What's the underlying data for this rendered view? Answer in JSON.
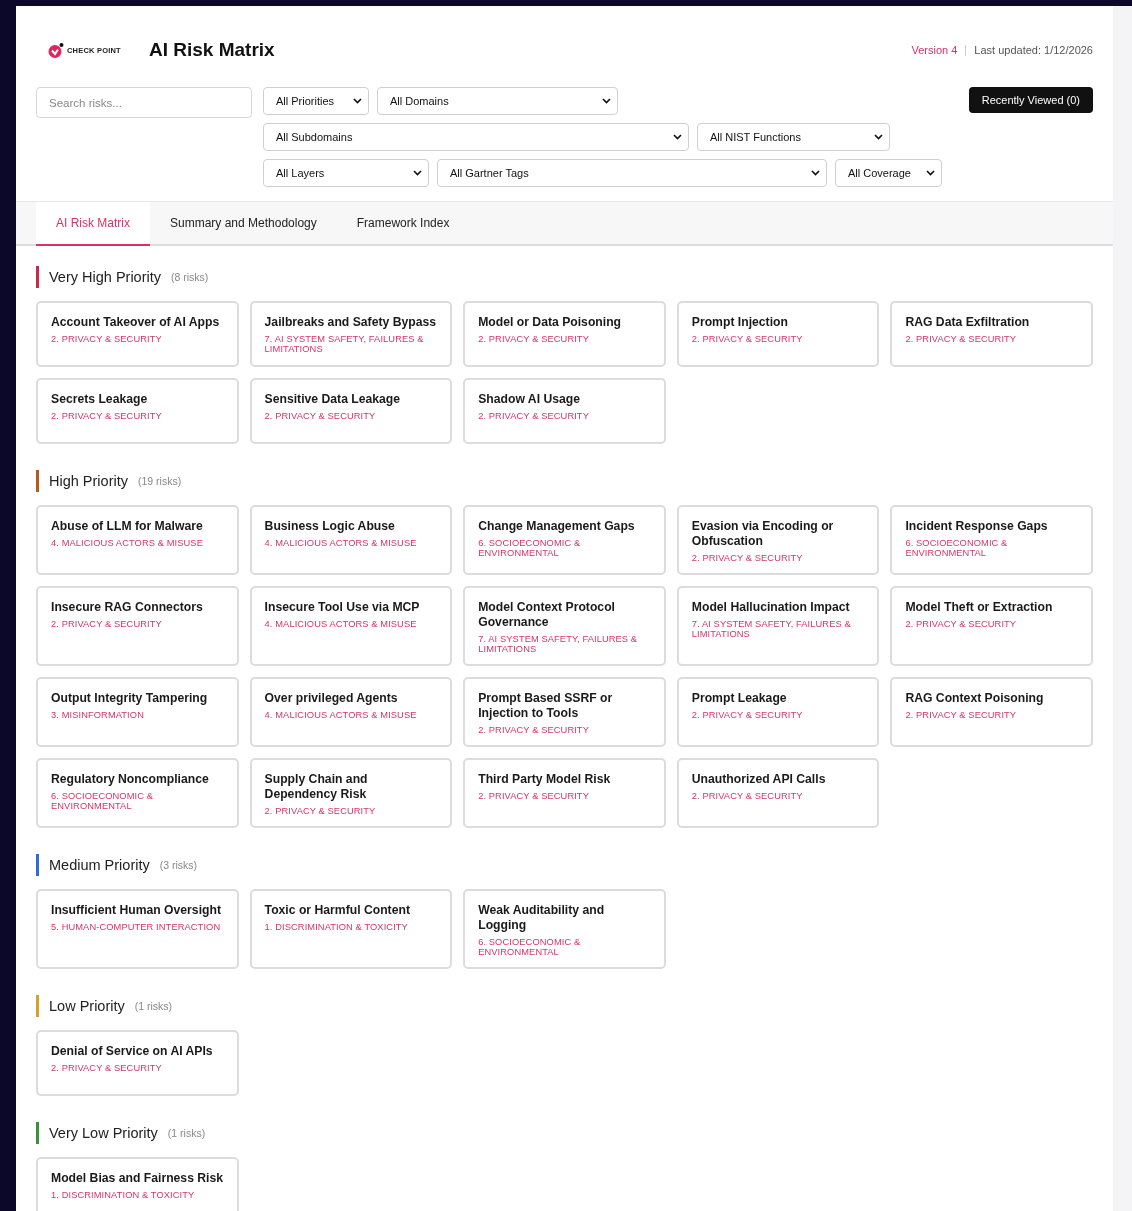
{
  "header": {
    "logo_text": "CHECK POINT",
    "title": "AI Risk Matrix",
    "version": "Version 4",
    "last_updated": "Last updated: 1/12/2026"
  },
  "filters": {
    "search": {
      "placeholder": "Search risks..."
    },
    "rows": [
      [
        {
          "label": "All Priorities"
        },
        {
          "label": "All Domains"
        }
      ],
      [
        {
          "label": "All Subdomains"
        },
        {
          "label": "All NIST Functions"
        }
      ],
      [
        {
          "label": "All Layers"
        },
        {
          "label": "All Gartner Tags"
        },
        {
          "label": "All Coverage"
        }
      ]
    ],
    "button": "Recently Viewed (0)"
  },
  "tabs": [
    {
      "label": "AI Risk Matrix",
      "selected": true
    },
    {
      "label": "Summary and Methodology",
      "selected": false
    },
    {
      "label": "Framework Index",
      "selected": false
    }
  ],
  "sections": [
    {
      "title": "Very High Priority",
      "count": "(8 risks)",
      "color": "#c8284a",
      "risks": [
        {
          "title": "Account Takeover of AI Apps",
          "category": "2. PRIVACY & SECURITY"
        },
        {
          "title": "Jailbreaks and Safety Bypass",
          "category": "7. AI SYSTEM SAFETY, FAILURES & LIMITATIONS"
        },
        {
          "title": "Model or Data Poisoning",
          "category": "2. PRIVACY & SECURITY"
        },
        {
          "title": "Prompt Injection",
          "category": "2. PRIVACY & SECURITY"
        },
        {
          "title": "RAG Data Exfiltration",
          "category": "2. PRIVACY & SECURITY"
        },
        {
          "title": "Secrets Leakage",
          "category": "2. PRIVACY & SECURITY"
        },
        {
          "title": "Sensitive Data Leakage",
          "category": "2. PRIVACY & SECURITY"
        },
        {
          "title": "Shadow AI Usage",
          "category": "2. PRIVACY & SECURITY"
        }
      ]
    },
    {
      "title": "High Priority",
      "count": "(19 risks)",
      "color": "#b4591f",
      "risks": [
        {
          "title": "Abuse of LLM for Malware",
          "category": "4. MALICIOUS ACTORS & MISUSE"
        },
        {
          "title": "Business Logic Abuse",
          "category": "4. MALICIOUS ACTORS & MISUSE"
        },
        {
          "title": "Change Management Gaps",
          "category": "6. SOCIOECONOMIC & ENVIRONMENTAL"
        },
        {
          "title": "Evasion via Encoding or Obfuscation",
          "category": "2. PRIVACY & SECURITY"
        },
        {
          "title": "Incident Response Gaps",
          "category": "6. SOCIOECONOMIC & ENVIRONMENTAL"
        },
        {
          "title": "Insecure RAG Connectors",
          "category": "2. PRIVACY & SECURITY"
        },
        {
          "title": "Insecure Tool Use via MCP",
          "category": "4. MALICIOUS ACTORS & MISUSE"
        },
        {
          "title": "Model Context Protocol Governance",
          "category": "7. AI SYSTEM SAFETY, FAILURES & LIMITATIONS"
        },
        {
          "title": "Model Hallucination Impact",
          "category": "7. AI SYSTEM SAFETY, FAILURES & LIMITATIONS"
        },
        {
          "title": "Model Theft or Extraction",
          "category": "2. PRIVACY & SECURITY"
        },
        {
          "title": "Output Integrity Tampering",
          "category": "3. MISINFORMATION"
        },
        {
          "title": "Over privileged Agents",
          "category": "4. MALICIOUS ACTORS & MISUSE"
        },
        {
          "title": "Prompt Based SSRF or Injection to Tools",
          "category": "2. PRIVACY & SECURITY"
        },
        {
          "title": "Prompt Leakage",
          "category": "2. PRIVACY & SECURITY"
        },
        {
          "title": "RAG Context Poisoning",
          "category": "2. PRIVACY & SECURITY"
        },
        {
          "title": "Regulatory Noncompliance",
          "category": "6. SOCIOECONOMIC & ENVIRONMENTAL"
        },
        {
          "title": "Supply Chain and Dependency Risk",
          "category": "2. PRIVACY & SECURITY"
        },
        {
          "title": "Third Party Model Risk",
          "category": "2. PRIVACY & SECURITY"
        },
        {
          "title": "Unauthorized API Calls",
          "category": "2. PRIVACY & SECURITY"
        }
      ]
    },
    {
      "title": "Medium Priority",
      "count": "(3 risks)",
      "color": "#2d6bd8",
      "risks": [
        {
          "title": "Insufficient Human Oversight",
          "category": "5. HUMAN-COMPUTER INTERACTION"
        },
        {
          "title": "Toxic or Harmful Content",
          "category": "1. DISCRIMINATION & TOXICITY"
        },
        {
          "title": "Weak Auditability and Logging",
          "category": "6. SOCIOECONOMIC & ENVIRONMENTAL"
        }
      ]
    },
    {
      "title": "Low Priority",
      "count": "(1 risks)",
      "color": "#d4a32b",
      "risks": [
        {
          "title": "Denial of Service on AI APIs",
          "category": "2. PRIVACY & SECURITY"
        }
      ]
    },
    {
      "title": "Very Low Priority",
      "count": "(1 risks)",
      "color": "#3e8e3a",
      "risks": [
        {
          "title": "Model Bias and Fairness Risk",
          "category": "1. DISCRIMINATION & TOXICITY"
        }
      ]
    }
  ]
}
